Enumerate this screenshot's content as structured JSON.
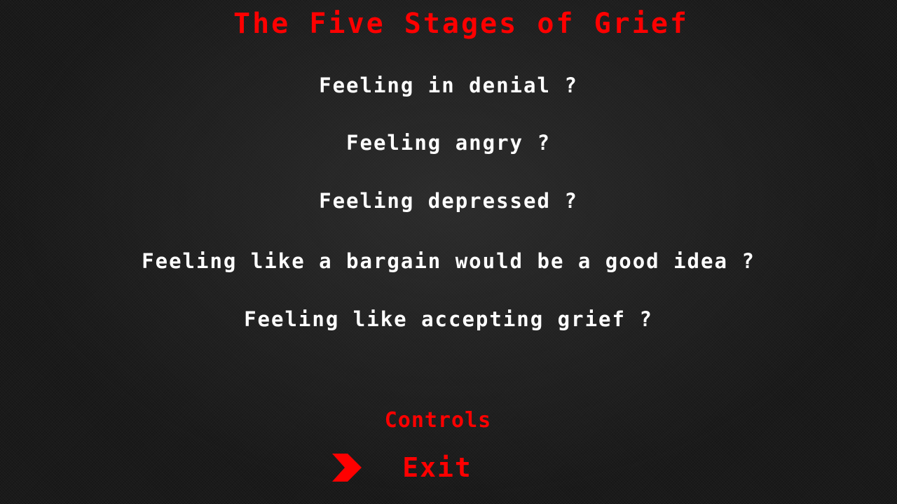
{
  "title": "The Five Stages of Grief",
  "stages": [
    "Feeling in denial ?",
    "Feeling angry ?",
    "Feeling depressed ?",
    "Feeling like a bargain would be a good idea ?",
    "Feeling like accepting grief ?"
  ],
  "menu": {
    "controls_label": "Controls",
    "exit_label": "Exit",
    "selected_item": "Exit"
  },
  "icons": {
    "selector": "chevron-right-icon"
  },
  "colors": {
    "accent": "#ff0000",
    "text": "#ffffff",
    "background": "#1a1a1a"
  }
}
